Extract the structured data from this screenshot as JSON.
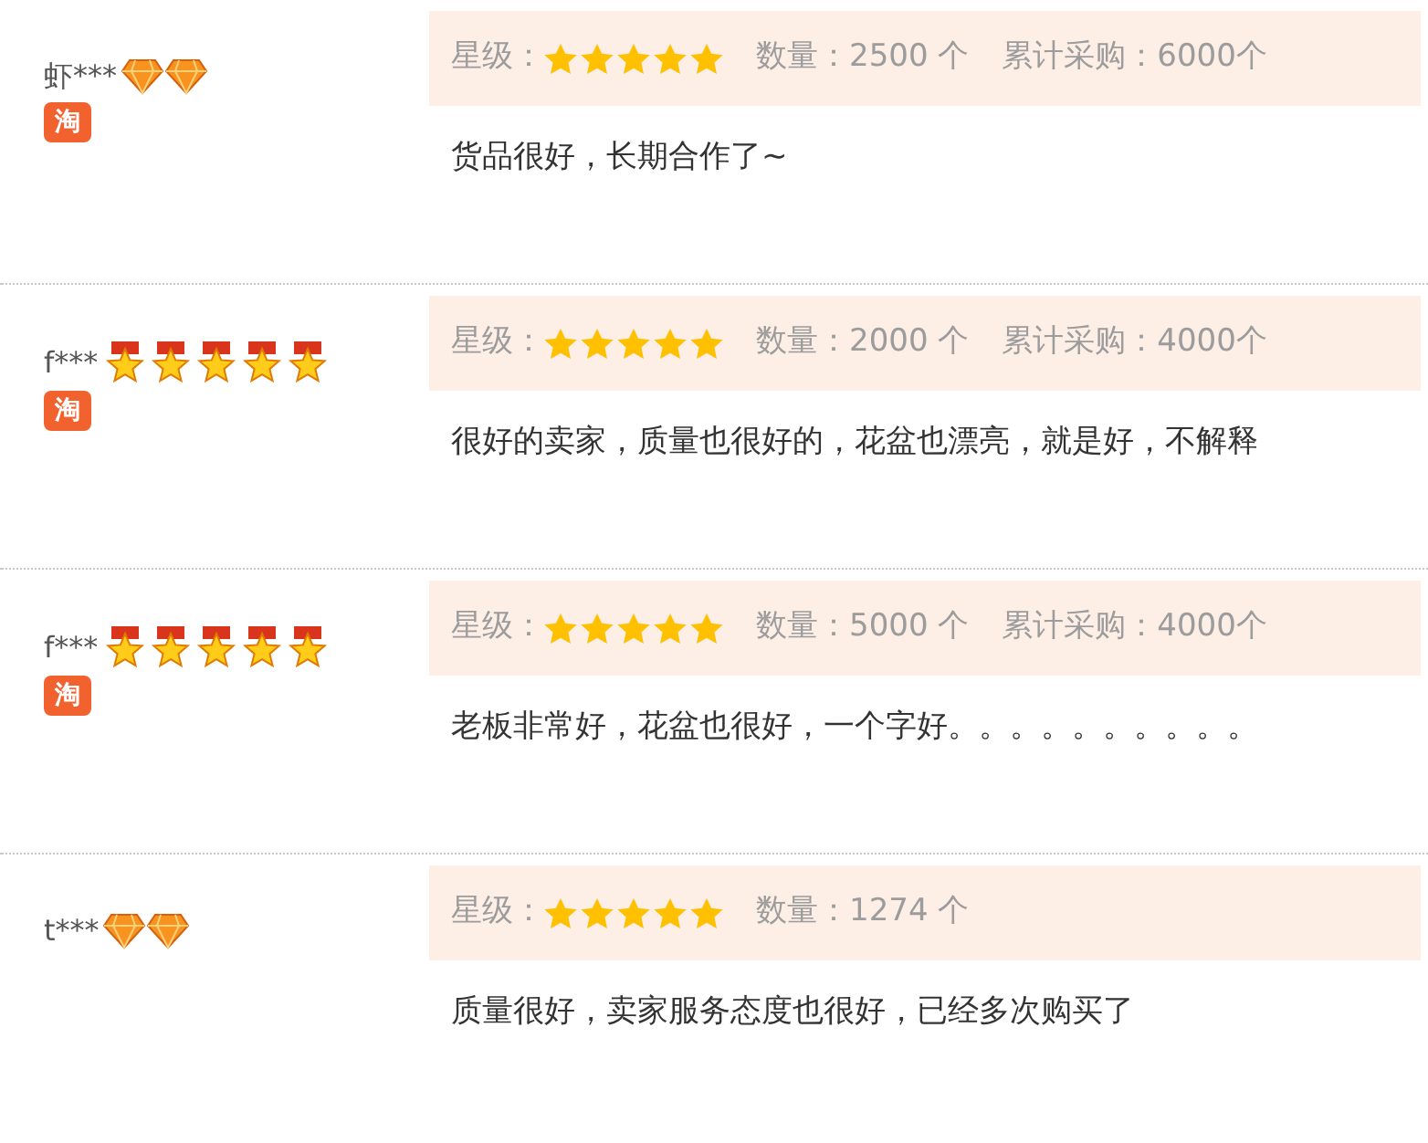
{
  "reviews": [
    {
      "buyer": "虾***",
      "badges": [
        {
          "kind": "diamond"
        },
        {
          "kind": "diamond"
        }
      ],
      "tao_icon": "淘",
      "rating_label": "星级：",
      "stars": 5,
      "quantity": "数量：2500 个",
      "total": "累计采购：6000个",
      "comment": "货品很好，长期合作了~"
    },
    {
      "buyer": "f***",
      "badges": [
        {
          "kind": "medal"
        },
        {
          "kind": "medal"
        },
        {
          "kind": "medal"
        },
        {
          "kind": "medal"
        },
        {
          "kind": "medal"
        }
      ],
      "tao_icon": "淘",
      "rating_label": "星级：",
      "stars": 5,
      "quantity": "数量：2000 个",
      "total": "累计采购：4000个",
      "comment": "很好的卖家，质量也很好的，花盆也漂亮，就是好，不解释"
    },
    {
      "buyer": "f***",
      "badges": [
        {
          "kind": "medal"
        },
        {
          "kind": "medal"
        },
        {
          "kind": "medal"
        },
        {
          "kind": "medal"
        },
        {
          "kind": "medal"
        }
      ],
      "tao_icon": "淘",
      "rating_label": "星级：",
      "stars": 5,
      "quantity": "数量：5000 个",
      "total": "累计采购：4000个",
      "comment": "老板非常好，花盆也很好，一个字好。。。。。。。。。。"
    },
    {
      "buyer": "t***",
      "badges": [
        {
          "kind": "diamond"
        },
        {
          "kind": "diamond"
        }
      ],
      "rating_label": "星级：",
      "stars": 5,
      "quantity": "数量：1274 个",
      "comment": "质量很好，卖家服务态度也很好，已经多次购买了"
    }
  ]
}
